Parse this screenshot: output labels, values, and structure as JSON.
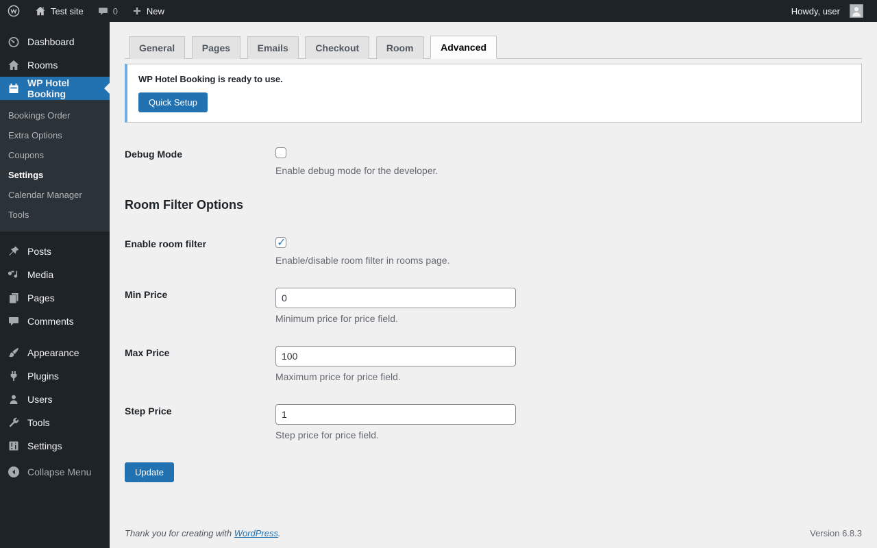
{
  "admin_bar": {
    "site_name": "Test site",
    "comments_count": "0",
    "new_label": "New",
    "howdy": "Howdy, user"
  },
  "sidebar": {
    "dashboard": "Dashboard",
    "rooms": "Rooms",
    "hotel_booking": "WP Hotel Booking",
    "submenu": {
      "bookings_order": "Bookings Order",
      "extra_options": "Extra Options",
      "coupons": "Coupons",
      "settings": "Settings",
      "calendar_manager": "Calendar Manager",
      "tools": "Tools"
    },
    "posts": "Posts",
    "media": "Media",
    "pages": "Pages",
    "comments": "Comments",
    "appearance": "Appearance",
    "plugins": "Plugins",
    "users": "Users",
    "tools": "Tools",
    "settings": "Settings",
    "collapse": "Collapse Menu"
  },
  "tabs": {
    "general": "General",
    "pages": "Pages",
    "emails": "Emails",
    "checkout": "Checkout",
    "room": "Room",
    "advanced": "Advanced",
    "active_tab": "Advanced"
  },
  "notice": {
    "title": "WP Hotel Booking is ready to use.",
    "button_label": "Quick Setup"
  },
  "form": {
    "debug": {
      "label": "Debug Mode",
      "checked": false,
      "desc": "Enable debug mode for the developer."
    },
    "section_heading": "Room Filter Options",
    "enable_filter": {
      "label": "Enable room filter",
      "checked": true,
      "desc": "Enable/disable room filter in rooms page."
    },
    "min_price": {
      "label": "Min Price",
      "value": "0",
      "desc": "Minimum price for price field."
    },
    "max_price": {
      "label": "Max Price",
      "value": "100",
      "desc": "Maximum price for price field."
    },
    "step_price": {
      "label": "Step Price",
      "value": "1",
      "desc": "Step price for price field."
    },
    "update_label": "Update"
  },
  "footer": {
    "thanks_prefix": "Thank you for creating with ",
    "wordpress_link": "WordPress",
    "thanks_suffix": ".",
    "version": "Version 6.8.3"
  },
  "icons": {
    "wp-logo-icon": "W in circle",
    "home-icon": "house",
    "comments-bubble-icon": "speech bubble",
    "plus-icon": "+",
    "avatar": "person silhouette",
    "dashboard-icon": "gauge",
    "rooms-icon": "house",
    "calendar-icon": "calendar",
    "pushpin-icon": "pin",
    "media-icon": "music note",
    "pages-icon": "stacked pages",
    "comment-icon": "speech bubble",
    "appearance-icon": "paintbrush",
    "plugins-icon": "plug",
    "users-icon": "person",
    "tools-icon": "wrench",
    "settings-icon": "sliders panel",
    "collapse-icon": "circle left arrow"
  },
  "colors": {
    "accent_blue": "#2271b1",
    "check_blue": "#3582c4",
    "notice_border": "#72aee6",
    "adminbar_bg": "#1d2327",
    "sidebar_bg": "#1d2327",
    "submenu_bg": "#2c3338",
    "content_bg": "#f0f0f1"
  }
}
